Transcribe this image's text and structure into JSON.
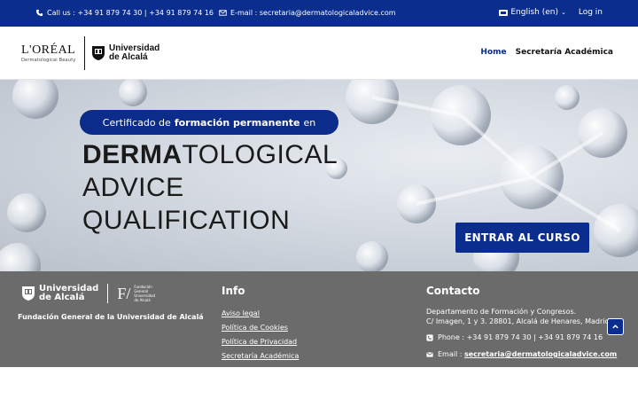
{
  "topbar": {
    "call_label": "Call us : +34 91 879 74 30 | +34 91 879 74 16",
    "email_label": "E-mail : secretaria@dermatologicaladvice.com",
    "language": "English (en)",
    "login": "Log in"
  },
  "header": {
    "loreal_brand": "L'ORÉAL",
    "loreal_sub": "Dermatological Beauty",
    "uah_line1": "Universidad",
    "uah_line2": "de Alcalá",
    "nav": [
      "Home",
      "Secretaría Académica"
    ]
  },
  "hero": {
    "pill_pre": "Certificado de",
    "pill_bold": "formación permanente",
    "pill_post": "en",
    "title_line1_bold": "DERMA",
    "title_line1_rest": "TOLOGICAL",
    "title_line2": "ADVICE",
    "title_line3": "QUALIFICATION",
    "cta": "ENTRAR AL CURSO"
  },
  "footer": {
    "uah_line1": "Universidad",
    "uah_line2": "de Alcalá",
    "f_mark": "F/",
    "f_small": "Fundación General Universidad de Alcalá",
    "org_name": "Fundación General de la Universidad de Alcalá",
    "info_heading": "Info",
    "info_links": [
      "Aviso legal",
      "Política de Cookies",
      "Política de Privacidad",
      "Secretaría Académica"
    ],
    "contact_heading": "Contacto",
    "dept_line1": "Departamento de Formación y Congresos.",
    "dept_line2": "C/ Imagen, 1 y 3. 28801, Alcalá de Henares, Madrid",
    "phone_label": "Phone : +34 91 879 74 30 | +34 91 879 74 16",
    "email_prefix": "Email :",
    "email_value": "secretaria@dermatologicaladvice.com"
  },
  "colors": {
    "brand_blue": "#0a2d8e",
    "footer_gray": "#6b6b6b"
  },
  "icons": [
    "phone-icon",
    "envelope-icon",
    "flag-icon",
    "chevron-down-icon",
    "shield-crest-icon",
    "arrow-up-icon"
  ]
}
